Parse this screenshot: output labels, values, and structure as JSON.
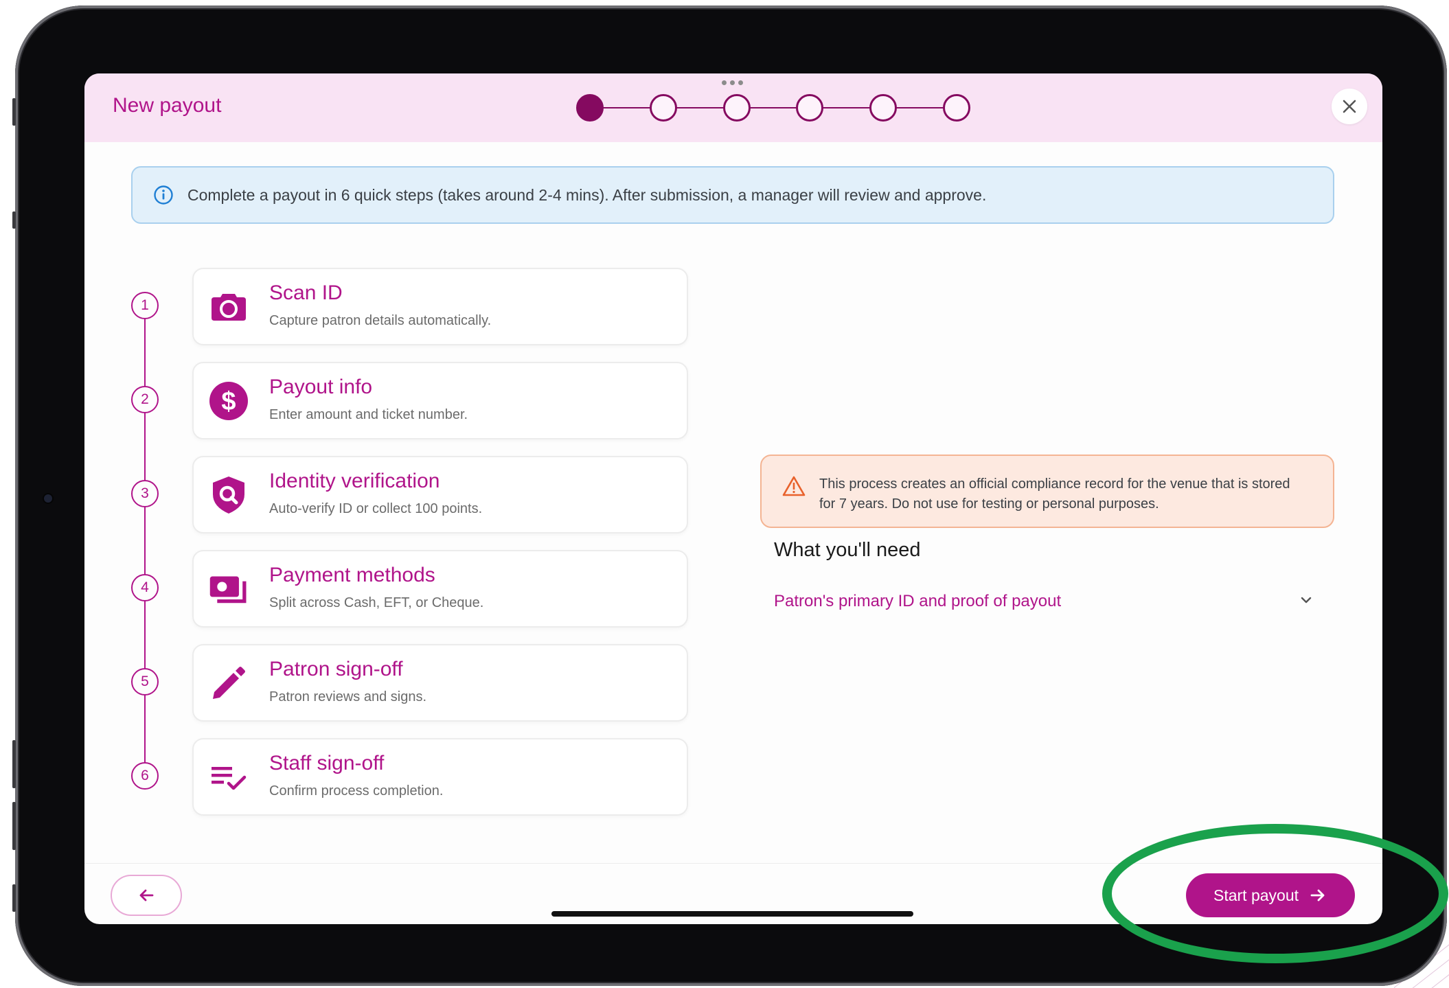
{
  "header": {
    "title": "New payout",
    "close_icon": "close-icon",
    "stepper": {
      "total_steps": 6,
      "current_step": 1
    }
  },
  "info_banner": {
    "icon": "info-icon",
    "text": "Complete a payout in 6 quick steps (takes around 2-4 mins). After submission, a manager will review and approve."
  },
  "steps": [
    {
      "number": "1",
      "title": "Scan ID",
      "subtitle": "Capture patron details automatically.",
      "icon": "camera-icon"
    },
    {
      "number": "2",
      "title": "Payout info",
      "subtitle": "Enter amount and ticket number.",
      "icon": "dollar-icon"
    },
    {
      "number": "3",
      "title": "Identity verification",
      "subtitle": "Auto-verify ID or collect 100 points.",
      "icon": "shield-search-icon"
    },
    {
      "number": "4",
      "title": "Payment methods",
      "subtitle": "Split across Cash, EFT, or Cheque.",
      "icon": "payments-icon"
    },
    {
      "number": "5",
      "title": "Patron sign-off",
      "subtitle": "Patron reviews and signs.",
      "icon": "pencil-icon"
    },
    {
      "number": "6",
      "title": "Staff sign-off",
      "subtitle": "Confirm process completion.",
      "icon": "checklist-icon"
    }
  ],
  "warning": {
    "icon": "warning-triangle-icon",
    "text": "This process creates an official compliance record for the venue that is stored for 7 years. Do not use for testing or personal purposes."
  },
  "needs": {
    "title": "What you'll need",
    "item_label": "Patron's primary ID and proof of payout",
    "chevron_icon": "chevron-down-icon"
  },
  "footer": {
    "back_icon": "arrow-left-icon",
    "start_label": "Start payout",
    "start_icon": "arrow-right-icon"
  },
  "colors": {
    "brand": "#b0148a",
    "brand_dark": "#850a60",
    "header_bg": "#f9e3f4",
    "info_bg": "#e2f0fa",
    "warning_bg": "#fde9e0",
    "highlight_ring": "#1aa14c"
  }
}
